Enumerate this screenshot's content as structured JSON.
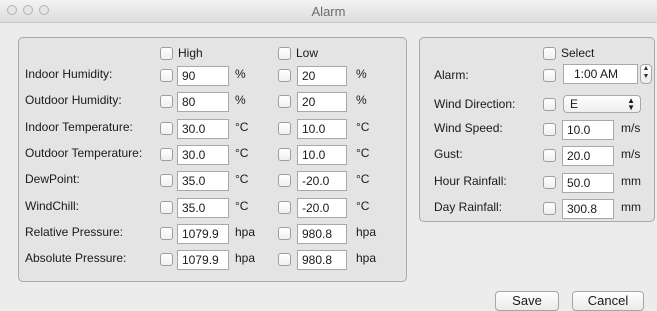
{
  "window": {
    "title": "Alarm"
  },
  "left_panel": {
    "high_label": "High",
    "low_label": "Low",
    "rows": [
      {
        "label": "Indoor Humidity:",
        "high": "90",
        "high_unit": "%",
        "low": "20",
        "low_unit": "%"
      },
      {
        "label": "Outdoor Humidity:",
        "high": "80",
        "high_unit": "%",
        "low": "20",
        "low_unit": "%"
      },
      {
        "label": "Indoor Temperature:",
        "high": "30.0",
        "high_unit": "°C",
        "low": "10.0",
        "low_unit": "°C"
      },
      {
        "label": "Outdoor Temperature:",
        "high": "30.0",
        "high_unit": "°C",
        "low": "10.0",
        "low_unit": "°C"
      },
      {
        "label": "DewPoint:",
        "high": "35.0",
        "high_unit": "°C",
        "low": "-20.0",
        "low_unit": "°C"
      },
      {
        "label": "WindChill:",
        "high": "35.0",
        "high_unit": "°C",
        "low": "-20.0",
        "low_unit": "°C"
      },
      {
        "label": "Relative Pressure:",
        "high": "1079.9",
        "high_unit": "hpa",
        "low": "980.8",
        "low_unit": "hpa"
      },
      {
        "label": "Absolute Pressure:",
        "high": "1079.9",
        "high_unit": "hpa",
        "low": "980.8",
        "low_unit": "hpa"
      }
    ]
  },
  "right_panel": {
    "select_label": "Select",
    "alarm": {
      "label": "Alarm:",
      "value": "1:00 AM"
    },
    "wind_direction": {
      "label": "Wind Direction:",
      "value": "E"
    },
    "rows": [
      {
        "label": "Wind Speed:",
        "value": "10.0",
        "unit": "m/s"
      },
      {
        "label": "Gust:",
        "value": "20.0",
        "unit": "m/s"
      },
      {
        "label": "Hour Rainfall:",
        "value": "50.0",
        "unit": "mm"
      },
      {
        "label": "Day Rainfall:",
        "value": "300.8",
        "unit": "mm"
      }
    ]
  },
  "buttons": {
    "save": "Save",
    "cancel": "Cancel"
  }
}
